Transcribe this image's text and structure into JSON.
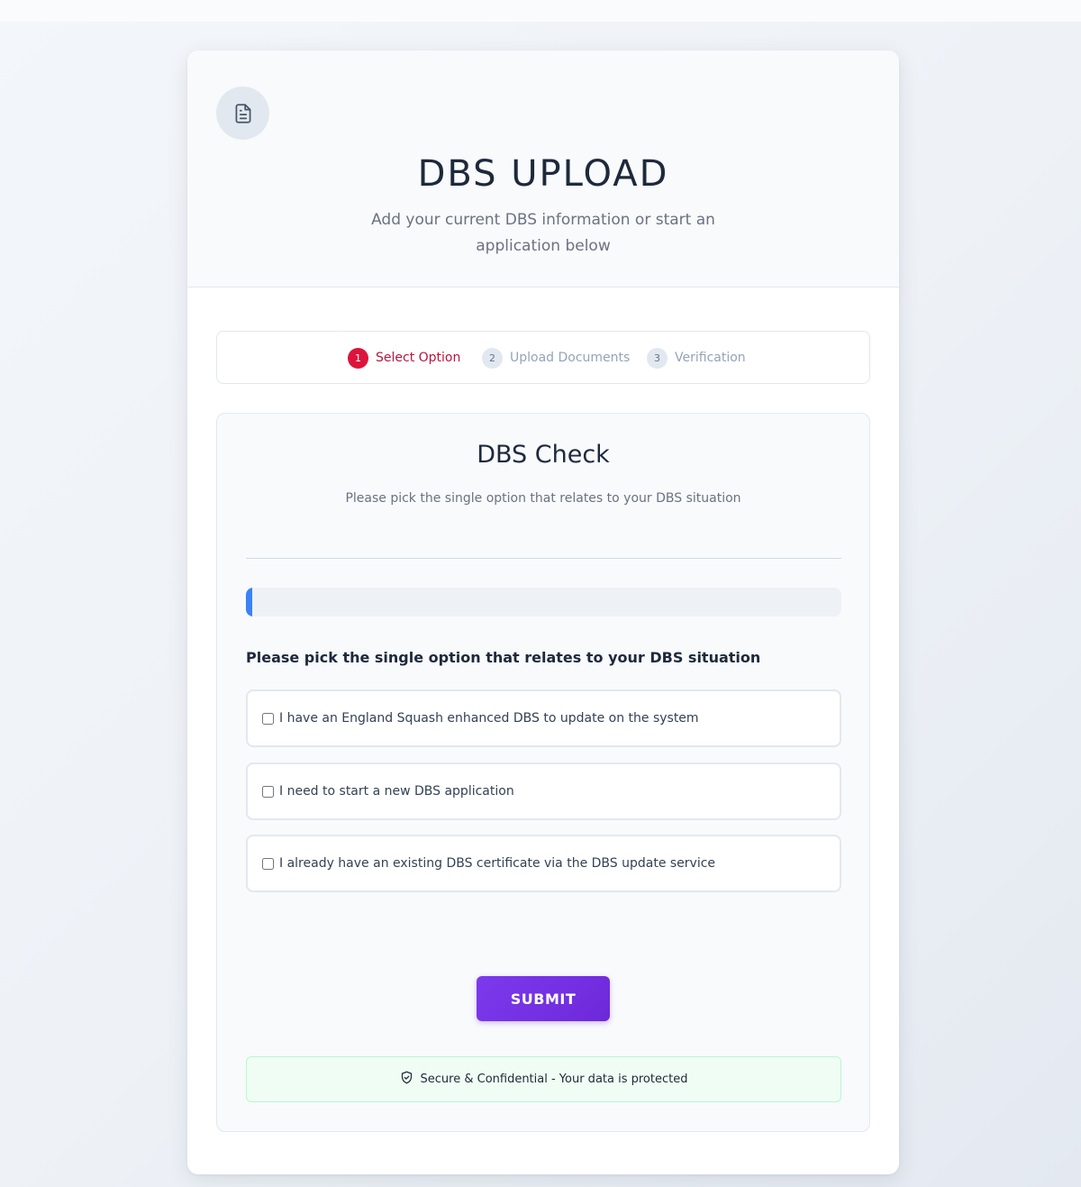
{
  "header": {
    "title": "DBS UPLOAD",
    "subtitle": "Add your current DBS information or start an application below",
    "icon": "document-icon"
  },
  "stepper": {
    "steps": [
      {
        "number": "1",
        "label": "Select Option",
        "active": true
      },
      {
        "number": "2",
        "label": "Upload Documents",
        "active": false
      },
      {
        "number": "3",
        "label": "Verification",
        "active": false
      }
    ]
  },
  "form": {
    "title": "DBS Check",
    "subtitle": "Please pick the single option that relates to your DBS situation",
    "progress_percent": 1,
    "question": "Please pick the single option that relates to your DBS situation",
    "options": [
      {
        "label": "I have an England Squash enhanced DBS to update on the system",
        "checked": false
      },
      {
        "label": "I need to start a new DBS application",
        "checked": false
      },
      {
        "label": "I already have an existing DBS certificate via the DBS update service",
        "checked": false
      }
    ],
    "submit_label": "SUBMIT",
    "security_note": "Secure & Confidential - Your data is protected",
    "security_icon": "shield-check-icon"
  },
  "colors": {
    "accent": "#dc143c",
    "submit": "#7c3aed",
    "progress": "#3b82f6"
  }
}
